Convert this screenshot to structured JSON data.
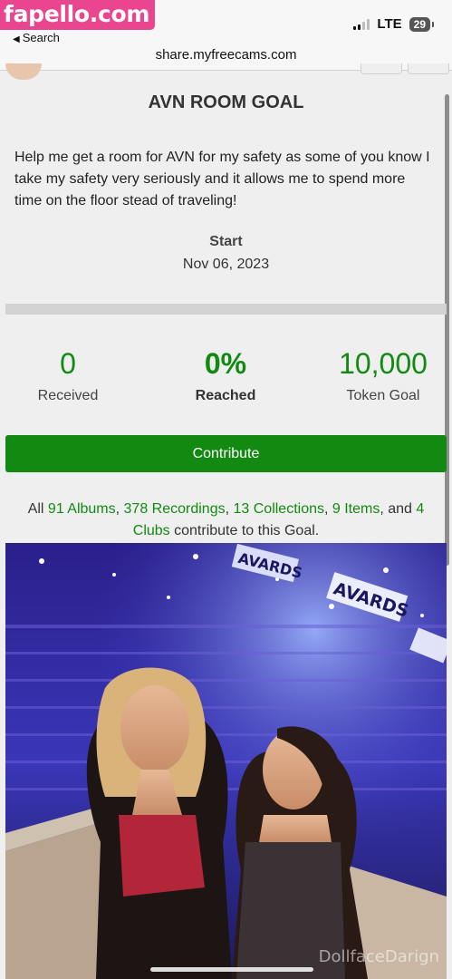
{
  "watermark_top": "fapello.com",
  "watermark_bottom": "DollfaceDarign",
  "status_bar": {
    "back_label": "Search",
    "network": "LTE",
    "battery": "29"
  },
  "browser": {
    "url": "share.myfreecams.com"
  },
  "goal": {
    "title": "AVN ROOM GOAL",
    "description": "Help me get a room for AVN for my safety as some of you know I take my safety very seriously and it allows me to spend more time on the floor stead of traveling!",
    "start_label": "Start",
    "start_date": "Nov 06, 2023",
    "progress_fraction": 0,
    "stats": {
      "received_value": "0",
      "received_label": "Received",
      "reached_value": "0%",
      "reached_label": "Reached",
      "goal_value": "10,000",
      "goal_label": "Token Goal"
    },
    "contribute_label": "Contribute",
    "contributors": {
      "prefix": "All",
      "albums": "91 Albums",
      "recordings": "378 Recordings",
      "collections": "13 Collections",
      "items": "9 Items",
      "and": "and",
      "clubs": "4 Clubs",
      "suffix": "contribute to this Goal."
    }
  },
  "photo": {
    "stage_text": "AVARDS"
  },
  "colors": {
    "accent_green": "#128a12",
    "page_bg": "#efefef",
    "watermark_pink": "#e9468f"
  }
}
